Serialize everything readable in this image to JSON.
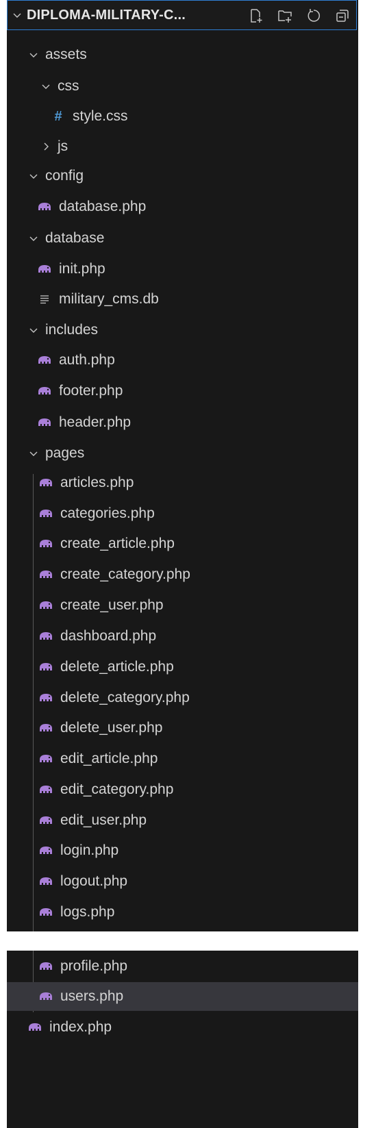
{
  "explorer": {
    "title": "DIPLOMA-MILITARY-C...",
    "actions": [
      {
        "name": "new-file-icon"
      },
      {
        "name": "new-folder-icon"
      },
      {
        "name": "refresh-icon"
      },
      {
        "name": "collapse-all-icon"
      }
    ]
  },
  "tree": {
    "assets": "assets",
    "css": "css",
    "style_css": "style.css",
    "js": "js",
    "config": "config",
    "database_php": "database.php",
    "database": "database",
    "init_php": "init.php",
    "military_cms_db": "military_cms.db",
    "includes": "includes",
    "auth_php": "auth.php",
    "footer_php": "footer.php",
    "header_php": "header.php",
    "pages": "pages",
    "pages_files": [
      "articles.php",
      "categories.php",
      "create_article.php",
      "create_category.php",
      "create_user.php",
      "dashboard.php",
      "delete_article.php",
      "delete_category.php",
      "delete_user.php",
      "edit_article.php",
      "edit_category.php",
      "edit_user.php",
      "login.php",
      "logout.php",
      "logs.php"
    ],
    "profile_php": "profile.php",
    "users_php": "users.php",
    "index_php": "index.php"
  },
  "colors": {
    "background": "#181818",
    "text": "#d4d4d4",
    "selected_row": "#37373d",
    "focus_border": "#2f7fd6",
    "php_icon": "#a97fd8",
    "css_hash": "#4f9ad6"
  }
}
